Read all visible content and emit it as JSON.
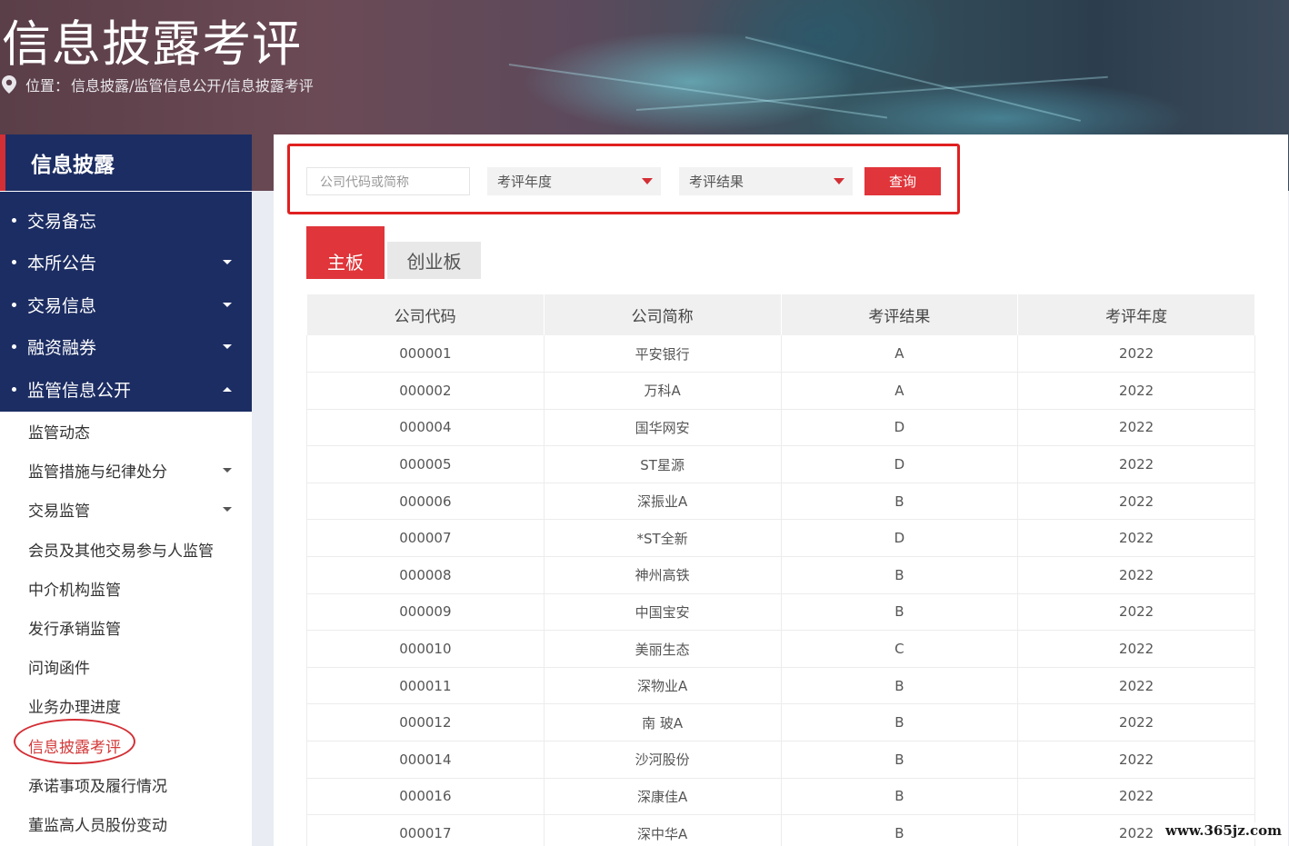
{
  "header": {
    "title": "信息披露考评",
    "location_label": "位置：",
    "breadcrumb": "信息披露/监管信息公开/信息披露考评"
  },
  "sidebar": {
    "heading": "信息披露",
    "main_items": [
      {
        "label": "交易备忘",
        "caret": "none"
      },
      {
        "label": "本所公告",
        "caret": "down"
      },
      {
        "label": "交易信息",
        "caret": "down"
      },
      {
        "label": "融资融券",
        "caret": "down"
      },
      {
        "label": "监管信息公开",
        "caret": "up"
      }
    ],
    "sub_items": [
      {
        "label": "监管动态",
        "caret": false,
        "active": false
      },
      {
        "label": "监管措施与纪律处分",
        "caret": true,
        "active": false
      },
      {
        "label": "交易监管",
        "caret": true,
        "active": false
      },
      {
        "label": "会员及其他交易参与人监管",
        "caret": false,
        "active": false
      },
      {
        "label": "中介机构监管",
        "caret": false,
        "active": false
      },
      {
        "label": "发行承销监管",
        "caret": false,
        "active": false
      },
      {
        "label": "问询函件",
        "caret": false,
        "active": false
      },
      {
        "label": "业务办理进度",
        "caret": false,
        "active": false
      },
      {
        "label": "信息披露考评",
        "caret": false,
        "active": true
      },
      {
        "label": "承诺事项及履行情况",
        "caret": false,
        "active": false
      },
      {
        "label": "董监高人员股份变动",
        "caret": false,
        "active": false
      }
    ]
  },
  "search": {
    "code_placeholder": "公司代码或简称",
    "year_select": "考评年度",
    "result_select": "考评结果",
    "query_label": "查询"
  },
  "tabs": [
    {
      "label": "主板",
      "active": true
    },
    {
      "label": "创业板",
      "active": false
    }
  ],
  "table": {
    "headers": [
      "公司代码",
      "公司简称",
      "考评结果",
      "考评年度"
    ],
    "rows": [
      [
        "000001",
        "平安银行",
        "A",
        "2022"
      ],
      [
        "000002",
        "万科A",
        "A",
        "2022"
      ],
      [
        "000004",
        "国华网安",
        "D",
        "2022"
      ],
      [
        "000005",
        "ST星源",
        "D",
        "2022"
      ],
      [
        "000006",
        "深振业A",
        "B",
        "2022"
      ],
      [
        "000007",
        "*ST全新",
        "D",
        "2022"
      ],
      [
        "000008",
        "神州高铁",
        "B",
        "2022"
      ],
      [
        "000009",
        "中国宝安",
        "B",
        "2022"
      ],
      [
        "000010",
        "美丽生态",
        "C",
        "2022"
      ],
      [
        "000011",
        "深物业A",
        "B",
        "2022"
      ],
      [
        "000012",
        "南 玻A",
        "B",
        "2022"
      ],
      [
        "000014",
        "沙河股份",
        "B",
        "2022"
      ],
      [
        "000016",
        "深康佳A",
        "B",
        "2022"
      ],
      [
        "000017",
        "深中华A",
        "B",
        "2022"
      ]
    ]
  },
  "watermark": "www.365jz.com",
  "colors": {
    "accent": "#e0353a",
    "nav": "#1c2d63",
    "annotation": "#d32f35"
  }
}
